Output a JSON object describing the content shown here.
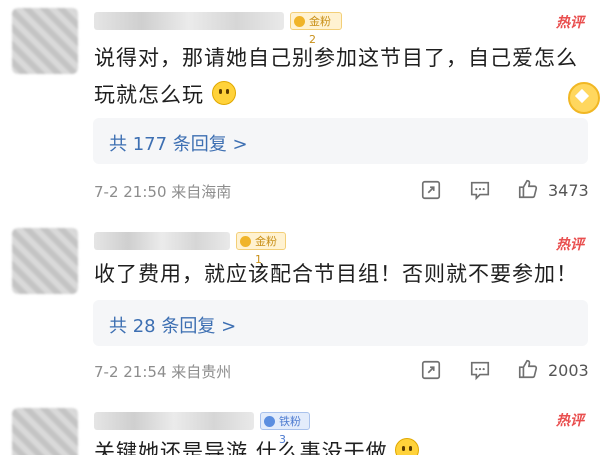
{
  "comments": [
    {
      "badge": "金粉2",
      "badge_type": "gold",
      "hot": "热评",
      "text": "说得对，那请她自己别参加这节目了，自己爱怎么玩就怎么玩",
      "emoji": "smile-emoji",
      "replies": "共 177 条回复 >",
      "time": "7-2 21:50 来自海南",
      "likes": "3473"
    },
    {
      "badge": "金粉1",
      "badge_type": "gold",
      "hot": "热评",
      "text": "收了费用，就应该配合节目组！否则就不要参加！",
      "replies": "共 28 条回复 >",
      "time": "7-2 21:54 来自贵州",
      "likes": "2003"
    },
    {
      "badge": "铁粉3",
      "badge_type": "iron",
      "hot": "热评",
      "text": "关键她还是导游 什么事没干做"
    }
  ],
  "colors": {
    "hot": "#e94f4f",
    "link": "#3d6fb2",
    "meta": "#8d8d8d"
  },
  "icons": [
    "share-icon",
    "comment-icon",
    "like-icon",
    "gold-fan-icon"
  ]
}
